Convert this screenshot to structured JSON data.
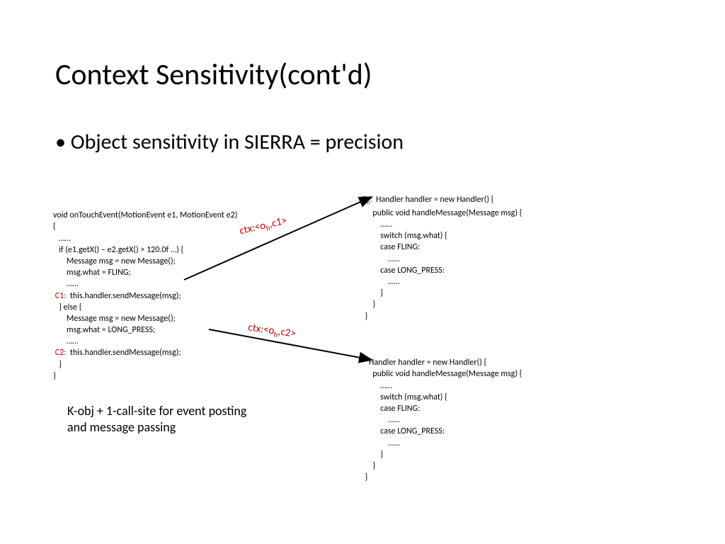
{
  "title": "Context Sensitivity(cont'd)",
  "bullet": "Object sensitivity in SIERRA = precision",
  "leftCode": {
    "l1": "void onTouchEvent(MotionEvent e1, MotionEvent e2)",
    "l2": "{",
    "l3": "   ……",
    "l4": "   if (e1.getX() – e2.getX() > 120.0f …) {",
    "l5": "       Message msg = new Message();",
    "l6": "       msg.what = FLING;",
    "l7": "       ……",
    "c1label": " C1:",
    "l8": "  this.handler.sendMessage(msg);",
    "l9": "   } else {",
    "l10": "       Message msg = new Message();",
    "l11": "       msg.what = LONG_PRESS;",
    "l12": "       ……",
    "c2label": " C2:",
    "l13": "  this.handler.sendMessage(msg);",
    "l14": "   }",
    "l15": "}"
  },
  "rightTop": {
    "ohlabel": "O",
    "ohsub": "h",
    "ohcolon": ":",
    "l1": "  Handler handler = new Handler() {",
    "l2": "      public void handleMessage(Message msg) {",
    "l3": "          ……",
    "l4": "          switch (msg.what) {",
    "l5": "          case FLING:",
    "l6": "              ……",
    "l7": "          case LONG_PRESS:",
    "l8": "              ……",
    "l9": "          }",
    "l10": "      }",
    "l11": "  }"
  },
  "rightBottom": {
    "l1": "    Handler handler = new Handler() {",
    "l2": "      public void handleMessage(Message msg) {",
    "l3": "          ……",
    "l4": "          switch (msg.what) {",
    "l5": "          case FLING:",
    "l6": "              ……",
    "l7": "          case LONG_PRESS:",
    "l8": "              ……",
    "l9": "          }",
    "l10": "      }",
    "l11": "  }"
  },
  "footnote1": "K-obj + 1-call-site for event posting",
  "footnote2": "and message passing",
  "ctx1_a": "ctx:<o",
  "ctx1_sub": "h",
  "ctx1_b": ",c1>",
  "ctx2_a": "ctx:<o",
  "ctx2_sub": "h",
  "ctx2_b": ",c2>"
}
